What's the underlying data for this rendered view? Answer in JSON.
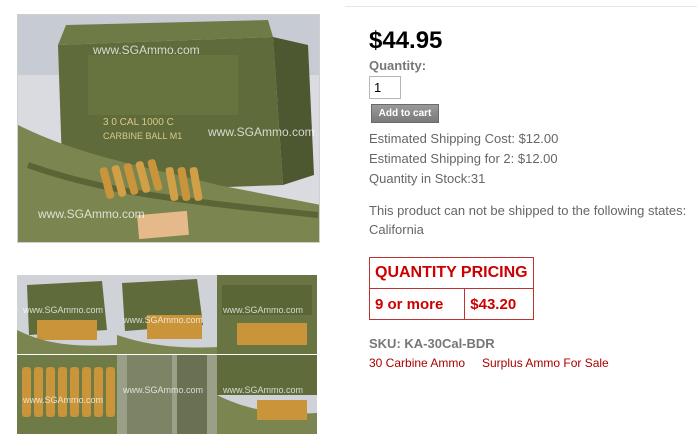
{
  "product": {
    "price": "$44.95",
    "quantity_label": "Quantity:",
    "quantity_value": "1",
    "add_to_cart_label": "Add to cart",
    "shipping_cost": "Estimated Shipping Cost: $12.00",
    "shipping_for_2": "Estimated Shipping for 2: $12.00",
    "stock": "Quantity in Stock:31",
    "restriction_note": "This product can not be shipped to the following states:",
    "restricted_state": "California",
    "sku": "SKU: KA-30Cal-BDR"
  },
  "quantity_pricing": {
    "header": "QUANTITY PRICING",
    "tier_label": "9 or more",
    "tier_price": "$43.20"
  },
  "categories": [
    "30 Carbine Ammo",
    "Surplus Ammo For Sale"
  ],
  "gallery": {
    "watermark": "www.SGAmmo.com",
    "can_stencil_1": "3 0 CAL 1000 C",
    "can_stencil_2": "CARBINE BALL M1"
  },
  "colors": {
    "accent_red": "#cc0000",
    "can_green": "#5f6b3a",
    "brass": "#c9943a"
  }
}
